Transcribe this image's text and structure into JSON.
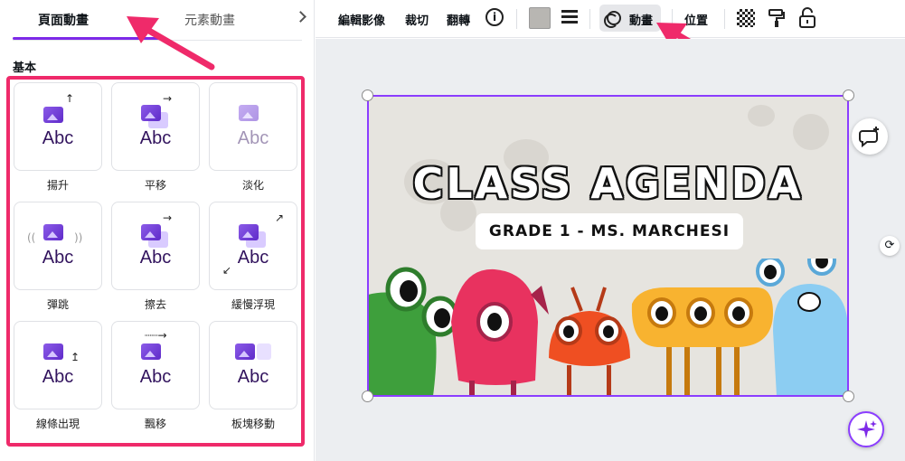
{
  "panel": {
    "tabs": [
      {
        "label": "頁面動畫",
        "active": true
      },
      {
        "label": "元素動畫",
        "active": false
      }
    ],
    "section_label": "基本",
    "tiles": [
      {
        "label": "揚升",
        "icon": "rise-icon"
      },
      {
        "label": "平移",
        "icon": "pan-icon"
      },
      {
        "label": "淡化",
        "icon": "fade-icon"
      },
      {
        "label": "彈跳",
        "icon": "bounce-icon"
      },
      {
        "label": "擦去",
        "icon": "wipe-icon"
      },
      {
        "label": "緩慢浮現",
        "icon": "slow-reveal-icon"
      },
      {
        "label": "線條出現",
        "icon": "line-reveal-icon"
      },
      {
        "label": "飄移",
        "icon": "drift-icon"
      },
      {
        "label": "板塊移動",
        "icon": "tectonic-icon"
      }
    ],
    "tile_text": "Abc"
  },
  "toolbar": {
    "edit_image": "編輯影像",
    "crop": "裁切",
    "flip": "翻轉",
    "info": "i",
    "animate": "動畫",
    "position": "位置",
    "swatch_color": "#b8b6b2",
    "accent": "#8b3dff"
  },
  "design": {
    "title": "CLASS AGENDA",
    "subtitle": "GRADE 1 - MS. MARCHESI"
  },
  "annotation_color": "#ef2a6a"
}
